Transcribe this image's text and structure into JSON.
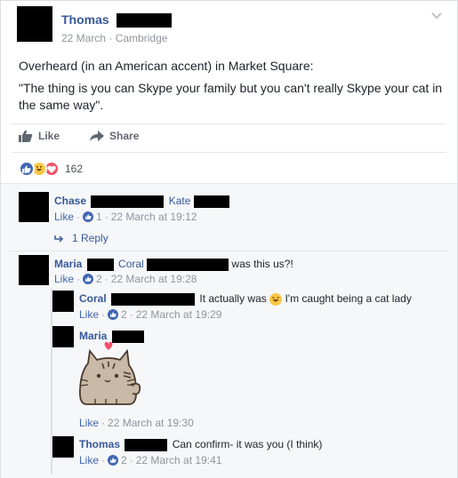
{
  "post": {
    "author": "Thomas",
    "date": "22 March",
    "location": "Cambridge",
    "meta_sep": "·",
    "line1": "Overheard (in an American accent) in Market Square:",
    "line2": "\"The thing is you can Skype your family but you can't really Skype your cat in the same way\".",
    "like_label": "Like",
    "share_label": "Share",
    "reaction_count": "162"
  },
  "comments": [
    {
      "name": "Chase",
      "text": "Kate",
      "likes": "1",
      "time": "22 March at 19:12",
      "like_label": "Like"
    },
    {
      "name": "Maria",
      "tag": "Coral",
      "text": "was this us?!",
      "likes": "2",
      "time": "22 March at 19:28",
      "like_label": "Like"
    },
    {
      "name": "Coral",
      "text_a": "It actually was",
      "text_b": "I'm caught being a cat lady",
      "likes": "2",
      "time": "22 March at 19:29",
      "like_label": "Like"
    },
    {
      "name": "Maria",
      "time": "22 March at 19:30",
      "like_label": "Like"
    },
    {
      "name": "Thomas",
      "text": "Can confirm- it was you (I think)",
      "likes": "2",
      "time": "22 March at 19:41",
      "like_label": "Like"
    }
  ],
  "reply": {
    "label": "1 Reply"
  },
  "colors": {
    "link": "#365899",
    "like_blue": "#4267b2",
    "haha": "#f7c845",
    "love": "#f25268"
  }
}
